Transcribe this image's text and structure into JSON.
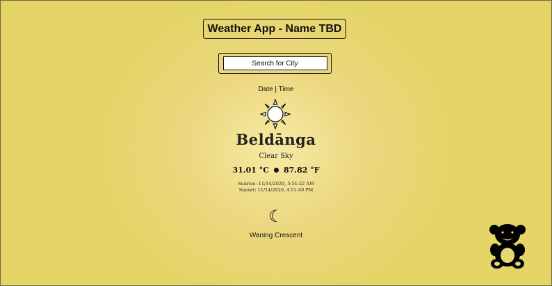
{
  "header": {
    "title": "Weather App - Name TBD"
  },
  "search": {
    "placeholder": "Search for City"
  },
  "main": {
    "datetime_label": "Date | Time",
    "condition_icon": "sun-icon",
    "city": "Beldānga",
    "condition": "Clear Sky",
    "temp_c": "31.01 °C",
    "temp_f": "87.82 °F",
    "sunrise": "Sunrise: 11/14/2020, 5:51:22 AM",
    "sunset": "Sunset: 11/14/2020, 4:51:40 PM",
    "moon_icon": "crescent-moon-icon",
    "moon_glyph": "☾",
    "moon_phase": "Waning Crescent"
  },
  "logo": {
    "icon": "teddy-bear-icon"
  },
  "colors": {
    "background": "#e4d566",
    "glow": "#f6eaa3",
    "ink": "#111111"
  }
}
